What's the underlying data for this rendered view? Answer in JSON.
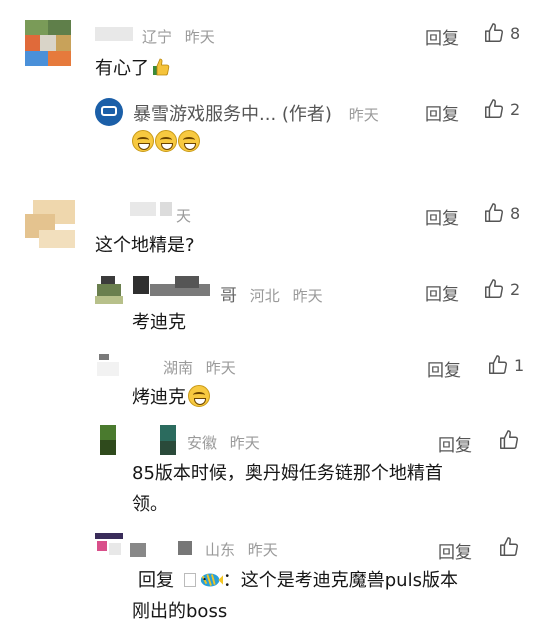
{
  "comments": [
    {
      "name": "辽宁",
      "time": "昨天",
      "text": "有心了",
      "emoji": "thumbs-up-emoji",
      "reply_label": "回复",
      "likes": "8",
      "replies": [
        {
          "name": "暴雪游戏服务中... (作者)",
          "time": "昨天",
          "reply_label": "回复",
          "likes": "2",
          "emoji": "grin-emoji x3"
        }
      ]
    },
    {
      "name": "天",
      "text": "这个地精是?",
      "reply_label": "回复",
      "likes": "8",
      "replies": [
        {
          "name": "哥",
          "place": "河北",
          "time": "昨天",
          "text": "考迪克",
          "reply_label": "回复",
          "likes": "2"
        },
        {
          "place": "湖南",
          "time": "昨天",
          "text": "烤迪克",
          "emoji": "grin-emoji",
          "reply_label": "回复",
          "likes": "1"
        },
        {
          "place": "安徽",
          "time": "昨天",
          "text_line1": "85版本时候，奥丹姆任务链那个地精首",
          "text_line2": "领。",
          "reply_label": "回复"
        },
        {
          "place": "山东",
          "time": "昨天",
          "reply_prefix": "回复",
          "reply_target_emoji": "fish-emoji",
          "text_line1": "：这个是考迪克魔兽puls版本",
          "text_line2": "刚出的boss",
          "reply_label": "回复"
        }
      ]
    }
  ]
}
